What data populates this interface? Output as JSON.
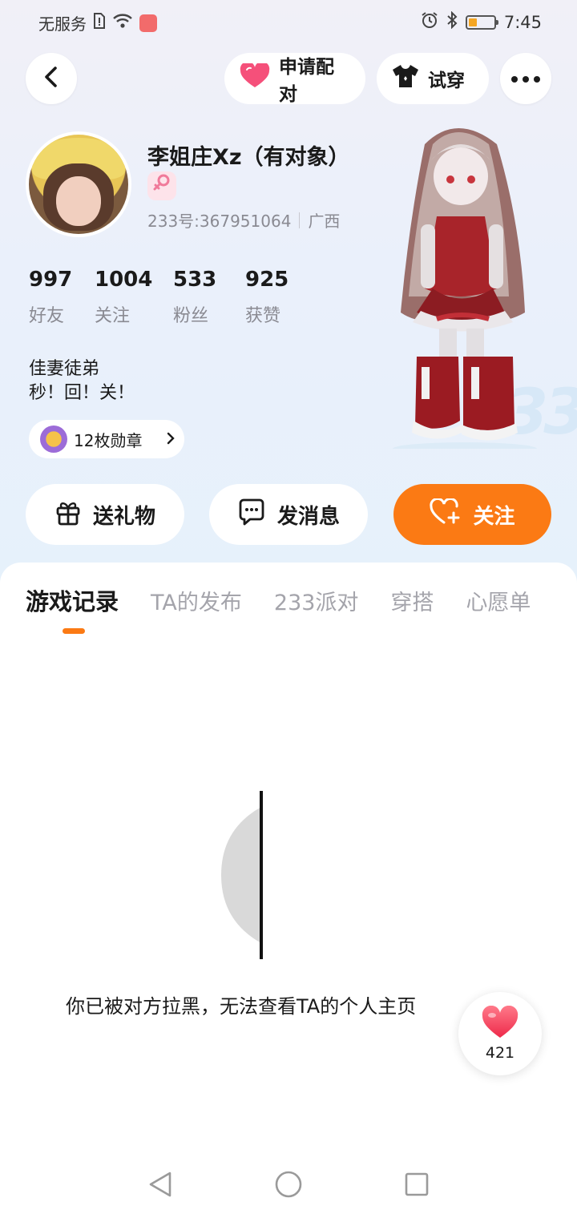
{
  "status_bar": {
    "carrier": "无服务",
    "time": "7:45",
    "battery_level": 0.2
  },
  "header": {
    "back_icon": "chevron-left-icon",
    "pair_label": "申请配对",
    "tryon_label": "试穿",
    "more_icon": "more-dots-icon"
  },
  "profile": {
    "username": "李姐庄Xz（有对象）",
    "gender_icon": "female-icon",
    "uid": "233号:367951064",
    "location": "广西",
    "stats": [
      {
        "value": "997",
        "label": "好友"
      },
      {
        "value": "1004",
        "label": "关注"
      },
      {
        "value": "533",
        "label": "粉丝"
      },
      {
        "value": "925",
        "label": "获赞"
      }
    ],
    "bio_line1": "佳妻徒弟",
    "bio_line2": "秒！回！关！",
    "medals": "12枚勋章"
  },
  "actions": {
    "gift": "送礼物",
    "message": "发消息",
    "follow": "关注"
  },
  "tabs": [
    "游戏记录",
    "TA的发布",
    "233派对",
    "穿搭",
    "心愿单"
  ],
  "content": {
    "blocked_message": "你已被对方拉黑，无法查看TA的个人主页"
  },
  "like_button": {
    "count": "421"
  },
  "colors": {
    "accent": "#fb7a14",
    "heart": "#f5507a"
  }
}
